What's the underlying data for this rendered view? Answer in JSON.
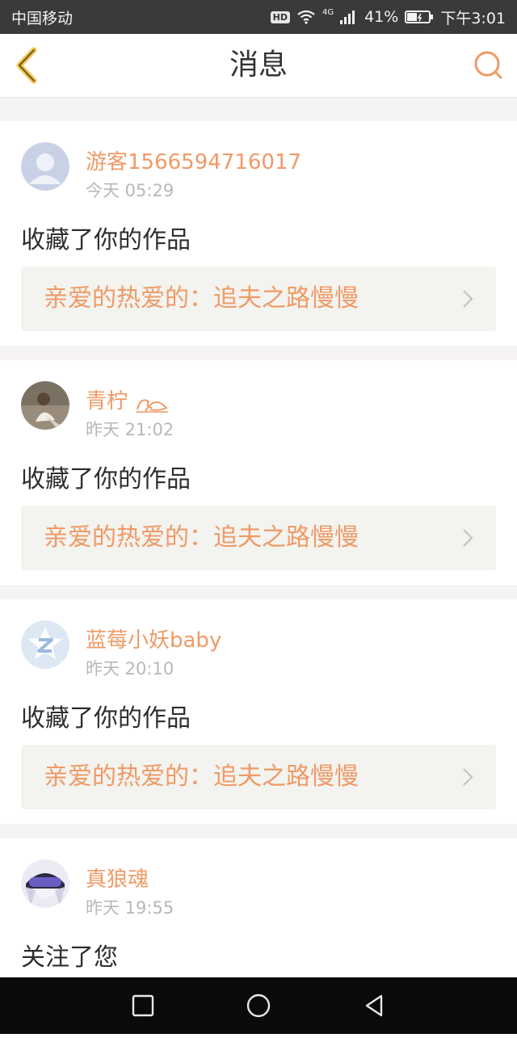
{
  "statusbar": {
    "carrier": "中国移动",
    "hd": "HD",
    "network": "4G",
    "battery": "41%",
    "time": "下午3:01"
  },
  "navbar": {
    "title": "消息"
  },
  "colors": {
    "accent": "#ef9a66",
    "work_bg": "#f3f3ef",
    "page_bg": "#f6f4f3"
  },
  "messages": [
    {
      "name": "游客1566594716017",
      "time": "今天 05:29",
      "action": "收藏了你的作品",
      "work": "亲爱的热爱的：追夫之路慢慢",
      "avatar": "default-avatar"
    },
    {
      "name": "青柠",
      "time": "昨天 21:02",
      "action": "收藏了你的作品",
      "work": "亲爱的热爱的：追夫之路慢慢",
      "avatar": "photo-avatar"
    },
    {
      "name": "蓝莓小妖baby",
      "time": "昨天 20:10",
      "action": "收藏了你的作品",
      "work": "亲爱的热爱的：追夫之路慢慢",
      "avatar": "z-logo-avatar"
    },
    {
      "name": "真狼魂",
      "time": "昨天 19:55",
      "action": "关注了您",
      "avatar": "anime-avatar"
    }
  ]
}
